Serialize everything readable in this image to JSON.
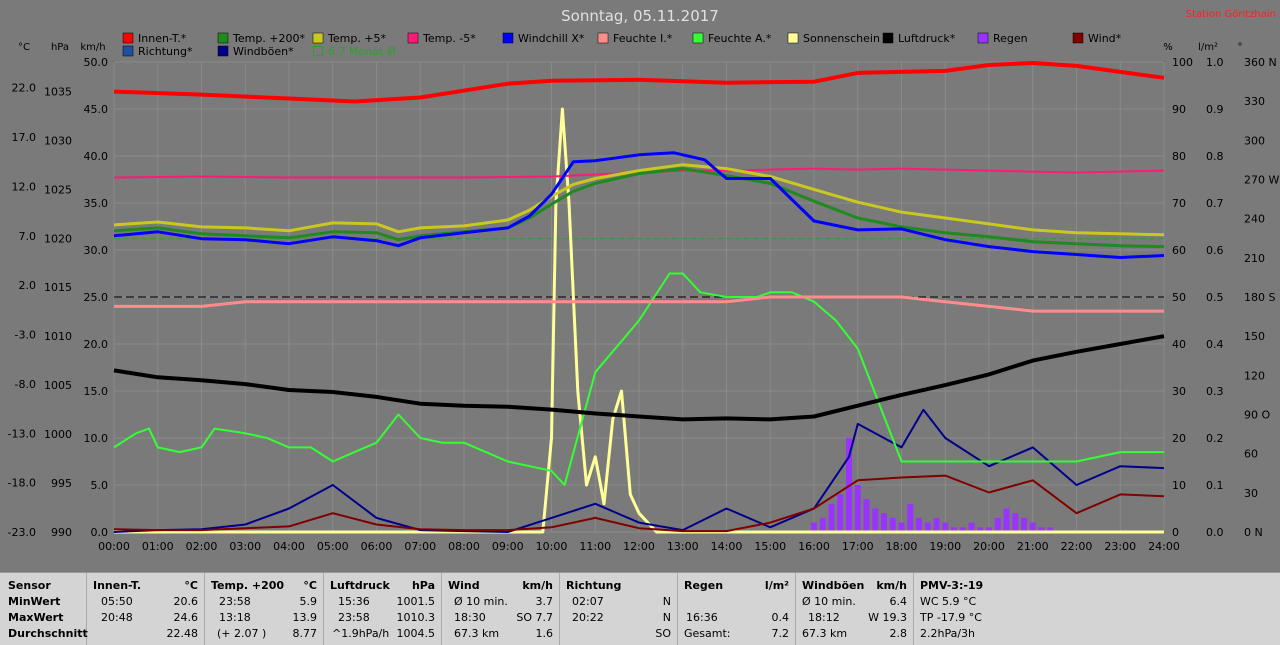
{
  "title": "Sonntag, 05.11.2017",
  "station": "Station Göritzhain",
  "colors": {
    "background": "#7a7a7a",
    "grid": "#8a8a8a",
    "innen": "#ff0000",
    "temp200": "#1f8a1f",
    "temp5": "#c8c820",
    "tempm5": "#ff1a75",
    "windchill": "#0000ff",
    "feuchteI": "#ff8c8c",
    "feuchteA": "#33ff33",
    "sonne": "#ffff99",
    "luftdruck": "#000000",
    "regen": "#9933ff",
    "wind": "#800000",
    "richtung": "#1f4f9f",
    "windboeen": "#00008b",
    "monat": "#2ca02c"
  },
  "legend": [
    {
      "label": "Innen-T.*",
      "color": "#ff0000"
    },
    {
      "label": "Temp. +200*",
      "color": "#1f8a1f"
    },
    {
      "label": "Temp. +5*",
      "color": "#c8c820"
    },
    {
      "label": "Temp. -5*",
      "color": "#ff1a75"
    },
    {
      "label": "Windchill X*",
      "color": "#0000ff"
    },
    {
      "label": "Feuchte I.*",
      "color": "#ff8c8c"
    },
    {
      "label": "Feuchte A.*",
      "color": "#33ff33"
    },
    {
      "label": "Sonnenschein",
      "color": "#ffff99"
    },
    {
      "label": "Luftdruck*",
      "color": "#000000"
    },
    {
      "label": "Regen",
      "color": "#9933ff"
    },
    {
      "label": "Wind*",
      "color": "#800000"
    },
    {
      "label": "Richtung*",
      "color": "#1f4f9f"
    },
    {
      "label": "Windböen*",
      "color": "#00008b"
    },
    {
      "label": "6.7 Monat-Ø",
      "color": "#2ca02c"
    }
  ],
  "axes": {
    "unit_c": "°C",
    "unit_hpa": "hPa",
    "unit_kmh": "km/h",
    "unit_pct": "%",
    "unit_lm2": "l/m²",
    "unit_deg": "°",
    "c_ticks": [
      "22.0",
      "17.0",
      "12.0",
      "7.0",
      "2.0",
      "-3.0",
      "-8.0",
      "-13.0",
      "-18.0",
      "-23.0"
    ],
    "hpa_ticks": [
      "1035",
      "1030",
      "1025",
      "1020",
      "1015",
      "1010",
      "1005",
      "1000",
      "995",
      "990"
    ],
    "kmh_ticks": [
      "50.0",
      "45.0",
      "40.0",
      "35.0",
      "30.0",
      "25.0",
      "20.0",
      "15.0",
      "10.0",
      "5.0",
      "0.0"
    ],
    "pct_ticks": [
      "100",
      "90",
      "80",
      "70",
      "60",
      "50",
      "40",
      "30",
      "20",
      "10",
      "0"
    ],
    "lm2_ticks": [
      "1.0",
      "0.9",
      "0.8",
      "0.7",
      "0.6",
      "0.5",
      "0.4",
      "0.3",
      "0.2",
      "0.1",
      "0.0"
    ],
    "deg_ticks": [
      "360 N",
      "330",
      "300",
      "270 W",
      "240",
      "210",
      "180 S",
      "150",
      "120",
      "90 O",
      "60",
      "30",
      "0 N"
    ],
    "time_ticks": [
      "00:00",
      "01:00",
      "02:00",
      "03:00",
      "04:00",
      "05:00",
      "06:00",
      "07:00",
      "08:00",
      "09:00",
      "10:00",
      "11:00",
      "12:00",
      "13:00",
      "14:00",
      "15:00",
      "16:00",
      "17:00",
      "18:00",
      "19:00",
      "20:00",
      "21:00",
      "22:00",
      "23:00",
      "24:00"
    ]
  },
  "chart_data": {
    "type": "line",
    "title": "Sonntag, 05.11.2017",
    "x_range": [
      0,
      24
    ],
    "ylim_c": [
      -23,
      24.6
    ],
    "ylim_hpa": [
      990,
      1038
    ],
    "ylim_kmh": [
      0,
      50
    ],
    "ylim_pct": [
      0,
      100
    ],
    "ylim_lm2": [
      0,
      1.0
    ],
    "ylim_deg": [
      0,
      360
    ],
    "grid": true,
    "series": [
      {
        "name": "Innen-T.*",
        "axis": "c",
        "x": [
          0,
          2,
          4,
          5.5,
          7,
          9,
          10,
          12,
          14,
          16,
          17,
          19,
          20,
          21,
          22,
          23,
          24
        ],
        "y": [
          21.6,
          21.3,
          20.9,
          20.6,
          21.0,
          22.4,
          22.7,
          22.8,
          22.5,
          22.6,
          23.5,
          23.7,
          24.3,
          24.5,
          24.2,
          23.6,
          23.0
        ]
      },
      {
        "name": "Temp. +200*",
        "axis": "c",
        "x": [
          0,
          1,
          2,
          3,
          4,
          5,
          6,
          6.5,
          7,
          8,
          9,
          9.5,
          10,
          10.5,
          11,
          12,
          13,
          14,
          15,
          16,
          17,
          18,
          19,
          20,
          21,
          22,
          23,
          24
        ],
        "y": [
          7.5,
          7.8,
          7.2,
          7.0,
          6.8,
          7.4,
          7.3,
          6.6,
          7.0,
          7.4,
          7.8,
          8.8,
          10.2,
          11.5,
          12.3,
          13.3,
          13.8,
          13.1,
          12.3,
          10.5,
          8.8,
          7.9,
          7.3,
          6.9,
          6.4,
          6.2,
          6.0,
          5.9
        ]
      },
      {
        "name": "Temp. +5*",
        "axis": "c",
        "x": [
          0,
          1,
          2,
          3,
          4,
          5,
          6,
          6.5,
          7,
          8,
          9,
          9.5,
          10,
          10.5,
          11,
          12,
          13,
          14,
          15,
          16,
          17,
          18,
          19,
          20,
          21,
          22,
          23,
          24
        ],
        "y": [
          8.1,
          8.4,
          7.9,
          7.8,
          7.5,
          8.3,
          8.2,
          7.4,
          7.8,
          8.0,
          8.6,
          9.6,
          11.0,
          12.2,
          12.8,
          13.6,
          14.2,
          13.8,
          13.0,
          11.7,
          10.4,
          9.4,
          8.8,
          8.2,
          7.6,
          7.3,
          7.2,
          7.1
        ]
      },
      {
        "name": "Temp. -5*",
        "axis": "c",
        "x": [
          0,
          2,
          4,
          6,
          8,
          10,
          12,
          13,
          14,
          16,
          17,
          18,
          20,
          22,
          24
        ],
        "y": [
          12.9,
          13.0,
          12.9,
          12.9,
          12.9,
          13.0,
          13.4,
          13.6,
          13.6,
          13.8,
          13.7,
          13.8,
          13.6,
          13.4,
          13.6
        ]
      },
      {
        "name": "Windchill X*",
        "axis": "c",
        "x": [
          0,
          1,
          2,
          3,
          4,
          5,
          6,
          6.5,
          7,
          8,
          9,
          9.5,
          10,
          10.5,
          11,
          12,
          12.8,
          13.5,
          14,
          15,
          16,
          17,
          18,
          19,
          20,
          21,
          22,
          23,
          24
        ],
        "y": [
          7.0,
          7.4,
          6.7,
          6.6,
          6.2,
          6.9,
          6.5,
          6.0,
          6.8,
          7.3,
          7.8,
          9.0,
          11.2,
          14.5,
          14.6,
          15.2,
          15.4,
          14.7,
          12.8,
          12.8,
          8.5,
          7.6,
          7.7,
          6.6,
          5.9,
          5.4,
          5.1,
          4.8,
          5.0
        ]
      },
      {
        "name": "Feuchte I.*",
        "axis": "pct",
        "x": [
          0,
          2,
          3,
          4,
          6,
          8,
          9,
          10,
          11,
          12,
          13,
          14,
          15,
          16,
          17,
          18,
          19,
          20,
          21,
          22,
          23,
          24
        ],
        "y": [
          48,
          48,
          49,
          49,
          49,
          49,
          49,
          49,
          49,
          49,
          49,
          49,
          50,
          50,
          50,
          50,
          49,
          48,
          47,
          47,
          47,
          47
        ]
      },
      {
        "name": "Feuchte A.*",
        "axis": "pct",
        "x": [
          0,
          0.5,
          0.8,
          1,
          1.5,
          2,
          2.3,
          3,
          3.5,
          4,
          4.5,
          5,
          5.5,
          6,
          6.5,
          7,
          7.5,
          8,
          9,
          9.5,
          10,
          10.3,
          11,
          12,
          12.7,
          13,
          13.4,
          14,
          14.7,
          15,
          15.5,
          16,
          16.5,
          17,
          18,
          19,
          20,
          22,
          23,
          24
        ],
        "y": [
          18,
          21,
          22,
          18,
          17,
          18,
          22,
          21,
          20,
          18,
          18,
          15,
          17,
          19,
          25,
          20,
          19,
          19,
          15,
          14,
          13,
          10,
          34,
          45,
          55,
          55,
          51,
          50,
          50,
          51,
          51,
          49,
          45,
          39,
          15,
          15,
          15,
          15,
          17,
          17
        ]
      },
      {
        "name": "Sonnenschein",
        "axis": "kmh",
        "x": [
          0,
          9.8,
          10,
          10.1,
          10.25,
          10.4,
          10.6,
          10.8,
          11,
          11.2,
          11.4,
          11.6,
          11.8,
          12,
          12.4,
          24
        ],
        "y": [
          0,
          0,
          10,
          35,
          45,
          35,
          15,
          5,
          8,
          3,
          12,
          15,
          4,
          2,
          0,
          0
        ]
      },
      {
        "name": "Luftdruck*",
        "axis": "hpa",
        "x": [
          0,
          1,
          2,
          3,
          4,
          5,
          6,
          7,
          8,
          9,
          10,
          11,
          12,
          13,
          14,
          15,
          16,
          17,
          18,
          19,
          20,
          21,
          22,
          23,
          24
        ],
        "y": [
          1006.5,
          1005.8,
          1005.5,
          1005.1,
          1004.5,
          1004.3,
          1003.8,
          1003.1,
          1002.9,
          1002.8,
          1002.5,
          1002.1,
          1001.8,
          1001.5,
          1001.6,
          1001.5,
          1001.8,
          1002.9,
          1004.0,
          1005.0,
          1006.1,
          1007.5,
          1008.4,
          1009.2,
          1010.0
        ]
      },
      {
        "name": "Wind*",
        "axis": "kmh",
        "x": [
          0,
          1,
          2,
          3,
          4,
          5,
          6,
          7,
          8,
          9,
          10,
          11,
          12,
          13,
          14,
          15,
          16,
          17,
          18,
          19,
          20,
          21,
          22,
          23,
          24
        ],
        "y": [
          0.3,
          0.2,
          0.2,
          0.4,
          0.6,
          2.0,
          0.8,
          0.3,
          0.2,
          0.2,
          0.5,
          1.5,
          0.4,
          0.1,
          0.1,
          1.0,
          2.5,
          5.5,
          5.8,
          6.0,
          4.2,
          5.5,
          2.0,
          4.0,
          3.8
        ]
      },
      {
        "name": "Windböen*",
        "axis": "kmh",
        "x": [
          0,
          1,
          2,
          3,
          4,
          5,
          6,
          7,
          8,
          9,
          10,
          11,
          12,
          13,
          14,
          15,
          16,
          16.8,
          17,
          18,
          18.5,
          19,
          20,
          21,
          22,
          23,
          24
        ],
        "y": [
          0,
          0.2,
          0.3,
          0.8,
          2.5,
          5.0,
          1.5,
          0.2,
          0.1,
          0,
          1.5,
          3.0,
          1.0,
          0.2,
          2.5,
          0.5,
          2.5,
          8.0,
          11.5,
          9.0,
          13.0,
          10.0,
          7.0,
          9.0,
          5.0,
          7.0,
          6.8
        ]
      }
    ],
    "rain": {
      "name": "Regen",
      "axis": "lm2",
      "x": [
        16.0,
        16.2,
        16.4,
        16.6,
        16.8,
        17.0,
        17.2,
        17.4,
        17.6,
        17.8,
        18.0,
        18.2,
        18.4,
        18.6,
        18.8,
        19.0,
        19.2,
        19.4,
        19.6,
        19.8,
        20.0,
        20.2,
        20.4,
        20.6,
        20.8,
        21.0,
        21.2,
        21.4
      ],
      "y": [
        0.02,
        0.03,
        0.06,
        0.08,
        0.2,
        0.1,
        0.07,
        0.05,
        0.04,
        0.03,
        0.02,
        0.06,
        0.03,
        0.02,
        0.03,
        0.02,
        0.01,
        0.01,
        0.02,
        0.01,
        0.01,
        0.03,
        0.05,
        0.04,
        0.03,
        0.02,
        0.01,
        0.01
      ]
    },
    "month_avg_c": 6.7
  },
  "stats": {
    "sensor": {
      "h": "Sensor",
      "min": "MinWert",
      "max": "MaxWert",
      "avg": "Durchschnitt"
    },
    "innen": {
      "h": "Innen-T.",
      "u": "°C",
      "min_t": "05:50",
      "min_v": "20.6",
      "max_t": "20:48",
      "max_v": "24.6",
      "avg": "22.48"
    },
    "temp200": {
      "h": "Temp. +200",
      "u": "°C",
      "min_t": "23:58",
      "min_v": "5.9",
      "max_t": "13:18",
      "max_v": "13.9",
      "avg_t": "(+ 2.07 )",
      "avg": "8.77"
    },
    "luftdruck": {
      "h": "Luftdruck",
      "u": "hPa",
      "min_t": "15:36",
      "min_v": "1001.5",
      "max_t": "23:58",
      "max_v": "1010.3",
      "avg_t": "^1.9hPa/h",
      "avg": "1004.5"
    },
    "wind": {
      "h": "Wind",
      "u": "km/h",
      "min_t": "Ø 10 min.",
      "min_v": "3.7",
      "max_t": "18:30",
      "max_v": "SO 7.7",
      "avg_t": "67.3 km",
      "avg": "1.6"
    },
    "richtung": {
      "h": "Richtung",
      "min_t": "02:07",
      "min_v": "N",
      "max_t": "20:22",
      "max_v": "N",
      "avg": "SO"
    },
    "regen": {
      "h": "Regen",
      "u": "l/m²",
      "max_t": "16:36",
      "max_v": "0.4",
      "avg_t": "Gesamt:",
      "avg": "7.2"
    },
    "windboeen": {
      "h": "Windböen",
      "u": "km/h",
      "min_t": "Ø 10 min.",
      "min_v": "6.4",
      "max_t": "18:12",
      "max_v": "W 19.3",
      "avg_t": "67.3 km",
      "avg": "2.8"
    },
    "pmv": {
      "h": "PMV-3:-19",
      "min": "WC 5.9 °C",
      "max": "TP -17.9 °C",
      "avg": "2.2hPa/3h"
    }
  }
}
